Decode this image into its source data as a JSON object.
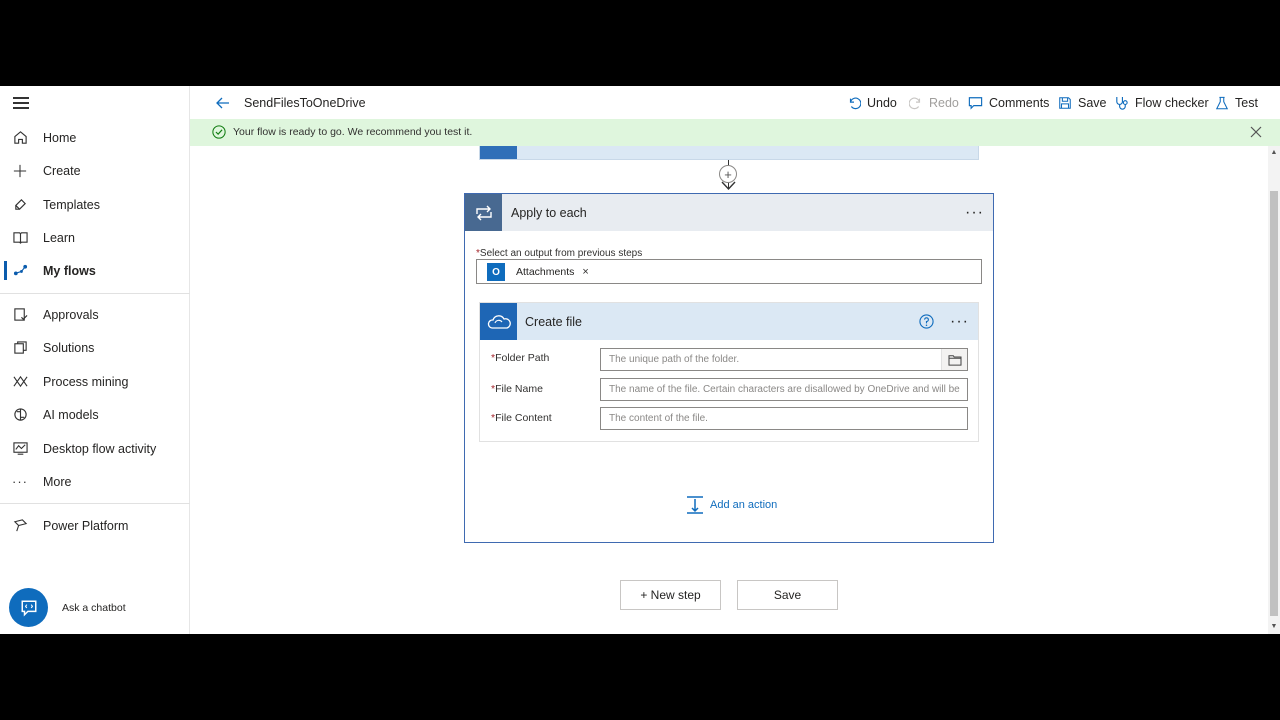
{
  "sidebar": {
    "items": [
      {
        "label": "Home",
        "icon": "home-icon"
      },
      {
        "label": "Create",
        "icon": "plus-icon"
      },
      {
        "label": "Templates",
        "icon": "templates-icon"
      },
      {
        "label": "Learn",
        "icon": "book-icon"
      },
      {
        "label": "My flows",
        "icon": "flows-icon",
        "active": true
      },
      {
        "label": "Approvals",
        "icon": "approvals-icon"
      },
      {
        "label": "Solutions",
        "icon": "solutions-icon"
      },
      {
        "label": "Process mining",
        "icon": "process-mining-icon"
      },
      {
        "label": "AI models",
        "icon": "ai-models-icon"
      },
      {
        "label": "Desktop flow activity",
        "icon": "desktop-activity-icon"
      },
      {
        "label": "More",
        "icon": "more-icon"
      },
      {
        "label": "Power Platform",
        "icon": "power-platform-icon"
      }
    ],
    "chatbot_label": "Ask a chatbot"
  },
  "header": {
    "title": "SendFilesToOneDrive",
    "commands": {
      "undo": "Undo",
      "redo": "Redo",
      "comments": "Comments",
      "save": "Save",
      "flow_checker": "Flow checker",
      "test": "Test"
    }
  },
  "banner": {
    "message": "Your flow is ready to go. We recommend you test it."
  },
  "apply_each": {
    "title": "Apply to each",
    "select_label": "Select an output from previous steps",
    "token_label": "Attachments",
    "token_remove": "×"
  },
  "create_file": {
    "title": "Create file",
    "fields": {
      "folder_path": {
        "label": "Folder Path",
        "placeholder": "The unique path of the folder."
      },
      "file_name": {
        "label": "File Name",
        "placeholder": "The name of the file. Certain characters are disallowed by OneDrive and will be"
      },
      "file_content": {
        "label": "File Content",
        "placeholder": "The content of the file."
      }
    }
  },
  "add_action_label": "Add an action",
  "buttons": {
    "new_step": "+ New step",
    "save": "Save"
  },
  "colors": {
    "accent": "#0f6cbd",
    "banner_bg": "#dff6dd",
    "apply_icon_bg": "#486991",
    "onedrive_icon_bg": "#1e66b5"
  }
}
